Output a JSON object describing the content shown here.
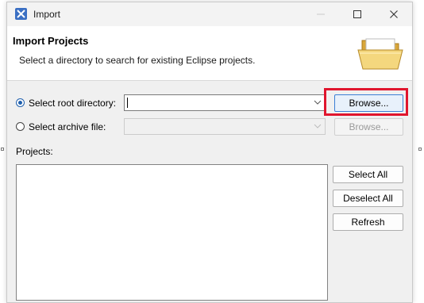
{
  "window": {
    "title": "Import"
  },
  "header": {
    "title": "Import Projects",
    "description": "Select a directory to search for existing Eclipse projects."
  },
  "root_dir": {
    "label": "Select root directory:",
    "selected": true,
    "value": "",
    "browse_label": "Browse..."
  },
  "archive": {
    "label": "Select archive file:",
    "selected": false,
    "value": "",
    "browse_label": "Browse..."
  },
  "projects": {
    "label": "Projects:",
    "items": [],
    "select_all_label": "Select All",
    "deselect_all_label": "Deselect All",
    "refresh_label": "Refresh"
  },
  "colors": {
    "highlight": "#e0152d",
    "accent": "#1f5fad",
    "app_icon": "#3a6fc3"
  }
}
